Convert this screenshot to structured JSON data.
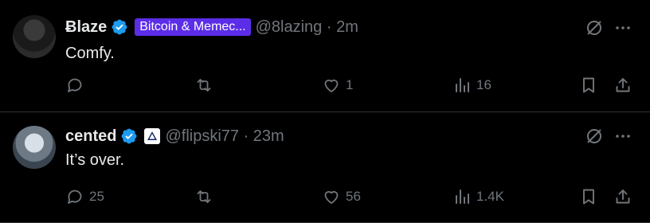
{
  "tweets": [
    {
      "author": "Ƀlaze",
      "label_badge": "Bitcoin & Memec...",
      "handle_time": "@8lazing · 2m",
      "text": "Comfy.",
      "replies": "",
      "reposts": "",
      "likes": "1",
      "views": "16"
    },
    {
      "author": "cented",
      "handle_time": "@flipski77 · 23m",
      "text": "It’s over.",
      "replies": "25",
      "reposts": "",
      "likes": "56",
      "views": "1.4K"
    }
  ],
  "colors": {
    "background": "#000000",
    "text": "#e7e9ea",
    "muted": "#71767b",
    "verified": "#1d9bf0",
    "badge": "#5b2de8",
    "divider": "#2f3336"
  },
  "icons": [
    "verified-badge-icon",
    "grok-icon",
    "more-icon",
    "reply-icon",
    "repost-icon",
    "like-icon",
    "views-icon",
    "bookmark-icon",
    "share-icon"
  ]
}
